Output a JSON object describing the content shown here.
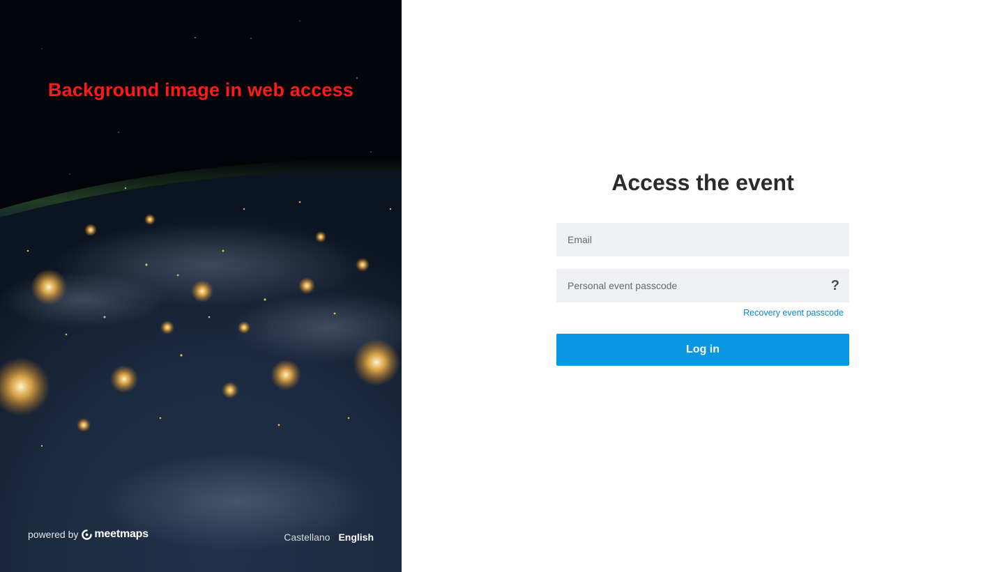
{
  "left_panel": {
    "annotation": "Background image in web access",
    "powered_by": {
      "prefix": "powered by",
      "brand": "meetmaps"
    },
    "languages": [
      {
        "label": "Castellano",
        "active": false
      },
      {
        "label": "English",
        "active": true
      }
    ]
  },
  "login_form": {
    "title": "Access the event",
    "email": {
      "placeholder": "Email",
      "value": ""
    },
    "passcode": {
      "placeholder": "Personal event passcode",
      "value": "",
      "help_icon": "?"
    },
    "recovery_link": "Recovery event passcode",
    "submit_label": "Log in"
  },
  "colors": {
    "accent": "#0897e0",
    "link": "#0a88cf",
    "annotation": "#ff1a1a",
    "field_bg": "#eff0f4",
    "title": "#2b2b2b"
  }
}
